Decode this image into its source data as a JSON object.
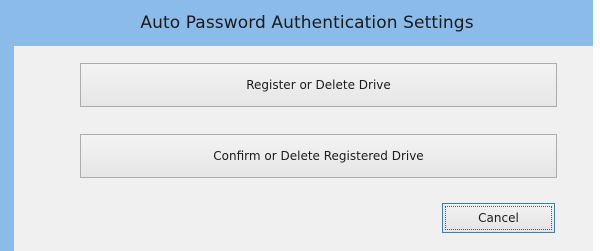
{
  "window": {
    "title": "Auto Password Authentication Settings"
  },
  "buttons": {
    "register_label": "Register or Delete Drive",
    "confirm_label": "Confirm or Delete Registered Drive",
    "cancel_label": "Cancel"
  },
  "colors": {
    "titlebar": "#8bbbe9",
    "client_background": "#f0f0f0",
    "default_button_border": "#3c7fb1"
  }
}
